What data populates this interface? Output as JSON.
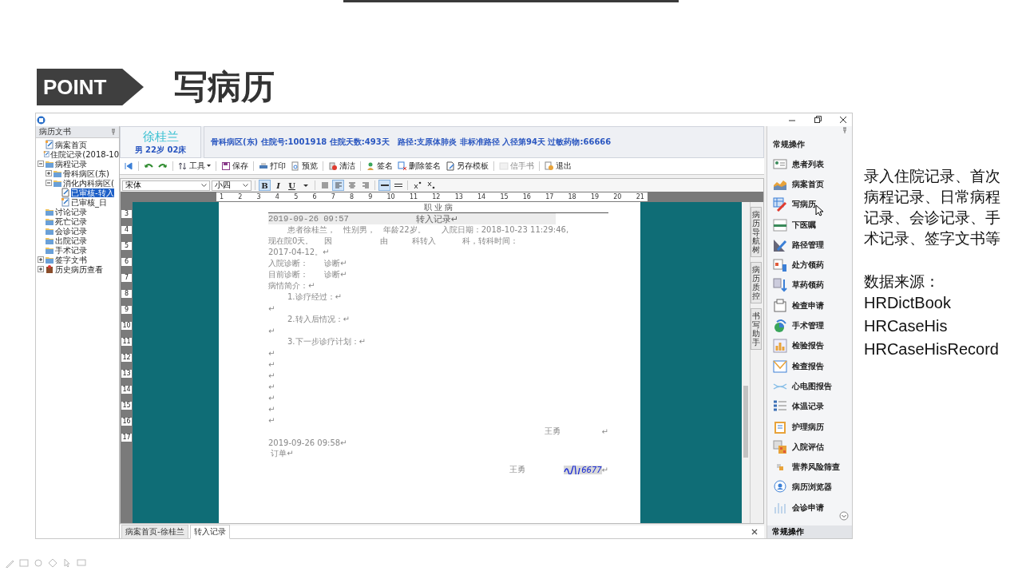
{
  "slide": {
    "badge": "POINT",
    "title": "写病历",
    "notes": "录入住院记录、首次病程记录、日常病程记录、会诊记录、手术记录、签字文书等",
    "source_label": "数据来源：",
    "sources": [
      "HRDictBook",
      "HRCaseHis",
      "HRCaseHisRecord"
    ]
  },
  "left_panel": {
    "title": "病历文书",
    "tree": [
      {
        "label": "病案首页",
        "kind": "doc",
        "selected": false
      },
      {
        "label": "住院记录(2018-10",
        "kind": "doc",
        "selected": false
      },
      {
        "label": "病程记录",
        "kind": "folder",
        "selected": false,
        "expanded": true,
        "children": [
          {
            "label": "骨科病区(东)",
            "kind": "folder",
            "selected": false,
            "expanded": false
          },
          {
            "label": "消化内科病区(",
            "kind": "folder",
            "selected": false,
            "expanded": true,
            "children": [
              {
                "label": "已审核-转入",
                "kind": "draft",
                "selected": true
              },
              {
                "label": "已审核_日",
                "kind": "doc",
                "selected": false
              }
            ]
          }
        ]
      },
      {
        "label": "讨论记录",
        "kind": "folder",
        "selected": false
      },
      {
        "label": "死亡记录",
        "kind": "folder",
        "selected": false
      },
      {
        "label": "会诊记录",
        "kind": "folder",
        "selected": false
      },
      {
        "label": "出院记录",
        "kind": "folder",
        "selected": false
      },
      {
        "label": "手术记录",
        "kind": "folder",
        "selected": false
      },
      {
        "label": "签字文书",
        "kind": "folder",
        "selected": false,
        "expanded": false
      },
      {
        "label": "历史病历查看",
        "kind": "history",
        "selected": false,
        "expanded": false
      }
    ]
  },
  "patient": {
    "name": "徐桂兰",
    "details": "男 22岁 02床",
    "info": "骨科病区(东) 住院号:1001918 住院天数:493天   路径:支原体肺炎 非标准路径 入径第94天 过敏药物:66666"
  },
  "toolbar": [
    {
      "kind": "first",
      "disabled": false
    },
    {
      "kind": "undo",
      "disabled": false
    },
    {
      "kind": "redo",
      "disabled": false
    },
    {
      "kind": "tools",
      "label": "工具",
      "disabled": false
    },
    {
      "kind": "save",
      "label": "保存",
      "disabled": false
    },
    {
      "kind": "print",
      "label": "打印",
      "disabled": false
    },
    {
      "kind": "preview",
      "label": "预览",
      "disabled": false
    },
    {
      "kind": "clean",
      "label": "清洁",
      "disabled": false
    },
    {
      "kind": "sign",
      "label": "签名",
      "disabled": false
    },
    {
      "kind": "unsign",
      "label": "删除签名",
      "disabled": false
    },
    {
      "kind": "template",
      "label": "另存模板",
      "disabled": false
    },
    {
      "kind": "handwrite",
      "label": "信手书",
      "disabled": true
    },
    {
      "kind": "exit",
      "label": "退出",
      "disabled": false
    }
  ],
  "format": {
    "font": "宋体",
    "size": "小四",
    "buttons": [
      {
        "kind": "text",
        "label": "B",
        "selected": true
      },
      {
        "kind": "text",
        "label": "I",
        "selected": false
      },
      {
        "kind": "text",
        "label": "U",
        "selected": false
      },
      {
        "kind": "caret",
        "selected": false
      },
      {
        "kind": "align-justify",
        "selected": false
      },
      {
        "kind": "align-left",
        "selected": true
      },
      {
        "kind": "align-center",
        "selected": false
      },
      {
        "kind": "align-right",
        "selected": false
      },
      {
        "kind": "line-single",
        "selected": true
      },
      {
        "kind": "line-double",
        "selected": false
      },
      {
        "kind": "superscript",
        "selected": false
      },
      {
        "kind": "subscript",
        "selected": false
      }
    ]
  },
  "ruler": {
    "horizontal": [
      "1",
      "2",
      "3",
      "4",
      "5",
      "6",
      "7",
      "8",
      "9",
      "10",
      "11",
      "12",
      "13",
      "14",
      "15",
      "16",
      "17",
      "18",
      "19",
      "20",
      "21"
    ],
    "vertical": [
      "3",
      "4",
      "5",
      "6",
      "7",
      "8",
      "9",
      "10",
      "11",
      "12",
      "13",
      "14",
      "15",
      "16",
      "17"
    ]
  },
  "document": {
    "header": "职 业 病",
    "lines": [
      {
        "kind": "heading",
        "date": "2019-09-26 09:57",
        "title": "转入记录↵"
      },
      {
        "kind": "indent",
        "text": "患者徐桂兰，　性别男，　年龄22岁。　　入院日期：2018-10-23 11:29:46,"
      },
      {
        "kind": "plain",
        "text": "现在院0天。　 因　　　　　　由　　　科转入　　　 科，转科时间："
      },
      {
        "kind": "plain",
        "text": "2017-04-12。↵"
      },
      {
        "kind": "plain",
        "text": "入院诊断：　　诊断↵"
      },
      {
        "kind": "plain",
        "text": "目前诊断：　　诊断↵"
      },
      {
        "kind": "plain",
        "text": "病情简介：↵"
      },
      {
        "kind": "indent",
        "text": "1.诊疗经过：↵"
      },
      {
        "kind": "plain",
        "text": "↵"
      },
      {
        "kind": "indent",
        "text": "2.转入后情况：↵"
      },
      {
        "kind": "plain",
        "text": "↵"
      },
      {
        "kind": "indent",
        "text": "3.下一步诊疗计划：↵"
      },
      {
        "kind": "plain",
        "text": "↵"
      },
      {
        "kind": "plain",
        "text": "↵"
      },
      {
        "kind": "plain",
        "text": "↵"
      },
      {
        "kind": "plain",
        "text": "↵"
      },
      {
        "kind": "plain",
        "text": "↵"
      },
      {
        "kind": "plain",
        "text": "↵"
      },
      {
        "kind": "plain",
        "text": "↵"
      },
      {
        "kind": "signature",
        "name": "王勇",
        "mark": "↵"
      },
      {
        "kind": "plain",
        "text": "2019-09-26 09:58↵"
      },
      {
        "kind": "plain",
        "text": " 订单↵"
      },
      {
        "kind": "signed",
        "name": "王勇",
        "sign": "6677",
        "mark": "↵"
      }
    ]
  },
  "vertical_tabs": [
    "病历导航树",
    "病历质控",
    "书写助手"
  ],
  "tabs": [
    {
      "label": "病案首页-徐桂兰",
      "selected": false
    },
    {
      "label": "转入记录",
      "selected": true
    }
  ],
  "right_panel": {
    "title": "常规操作",
    "items": [
      {
        "label": "患者列表",
        "kind": "card"
      },
      {
        "label": "病案首页",
        "kind": "chart"
      },
      {
        "label": "写病历",
        "kind": "write"
      },
      {
        "label": "下医嘱",
        "kind": "bar"
      },
      {
        "label": "路径管理",
        "kind": "path"
      },
      {
        "label": "处方领药",
        "kind": "rx"
      },
      {
        "label": "草药领药",
        "kind": "herb"
      },
      {
        "label": "检查申请",
        "kind": "apply"
      },
      {
        "label": "手术管理",
        "kind": "surgery"
      },
      {
        "label": "检验报告",
        "kind": "lab"
      },
      {
        "label": "检查报告",
        "kind": "report"
      },
      {
        "label": "心电图报告",
        "kind": "ecg"
      },
      {
        "label": "体温记录",
        "kind": "list"
      },
      {
        "label": "护理病历",
        "kind": "clip"
      },
      {
        "label": "入院评估",
        "kind": "grid"
      },
      {
        "label": "营养风险筛查",
        "kind": "small"
      },
      {
        "label": "病历浏览器",
        "kind": "pin"
      },
      {
        "label": "会诊申请",
        "kind": "bars"
      }
    ],
    "footer": "常规操作"
  }
}
